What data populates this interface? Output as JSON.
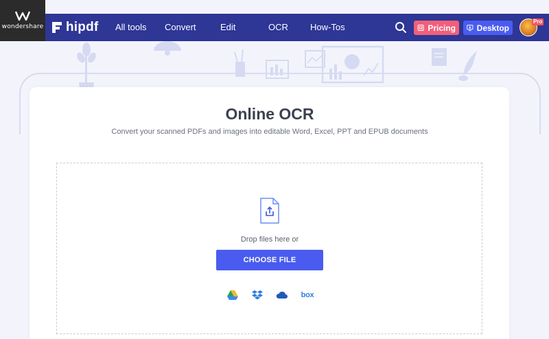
{
  "header": {
    "company": "wondershare",
    "brand": "hipdf",
    "nav": [
      "All tools",
      "Convert",
      "Edit",
      "OCR",
      "How-Tos"
    ],
    "pricing_label": "Pricing",
    "desktop_label": "Desktop",
    "pro_badge": "Pro"
  },
  "main": {
    "title": "Online OCR",
    "subtitle": "Convert your scanned PDFs and images into editable Word, Excel, PPT and EPUB documents",
    "drop_text": "Drop files here or",
    "choose_label": "CHOOSE FILE",
    "cloud_sources": [
      "google-drive-icon",
      "dropbox-icon",
      "onedrive-icon",
      "box-icon"
    ],
    "box_label": "box"
  },
  "colors": {
    "header_bg": "#2e3696",
    "accent": "#4a5cf0",
    "pricing": "#f25f7a",
    "page_bg": "#f3f4fb"
  }
}
